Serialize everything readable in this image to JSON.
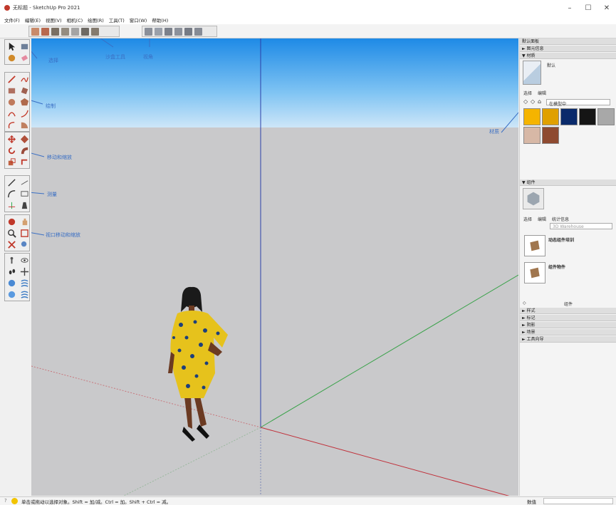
{
  "window": {
    "title": "无标题 - SketchUp Pro 2021",
    "minimize": "–",
    "maximize": "☐",
    "close": "✕"
  },
  "menu": {
    "items": [
      "文件(F)",
      "编辑(E)",
      "视图(V)",
      "相机(C)",
      "绘图(R)",
      "工具(T)",
      "窗口(W)",
      "帮助(H)"
    ]
  },
  "annotations": {
    "select": "选择",
    "sandbox": "沙盒工具",
    "views": "视角",
    "draw": "绘制",
    "move_scale": "移动和缩放",
    "measure": "测量",
    "view_move_zoom": "视口移动和缩放",
    "materials": "材质"
  },
  "tray": {
    "title": "默认面板",
    "section_entity_info": "图元信息",
    "section_materials": "材质",
    "material_name": "默认",
    "tab_select": "选择",
    "tab_edit": "编辑",
    "in_model": "在模型中",
    "section_components": "组件",
    "tab_stats": "统计信息",
    "search_placeholder": "3D Warehouse",
    "comp1": "动态组件培训",
    "comp2": "组件物件",
    "component_footer": "组件",
    "sections": [
      "样式",
      "标记",
      "阴影",
      "场景",
      "工具向导"
    ]
  },
  "swatches": [
    "#f5b400",
    "#e0a000",
    "#0a2a6b",
    "#151515",
    "#a8a8a8",
    "#d7b8a6",
    "#8e4a30"
  ],
  "status": {
    "message": "单击或拖动以选择对象。Shift = 加/减。Ctrl = 加。Shift + Ctrl = 减。",
    "vcb_label": "数值"
  }
}
